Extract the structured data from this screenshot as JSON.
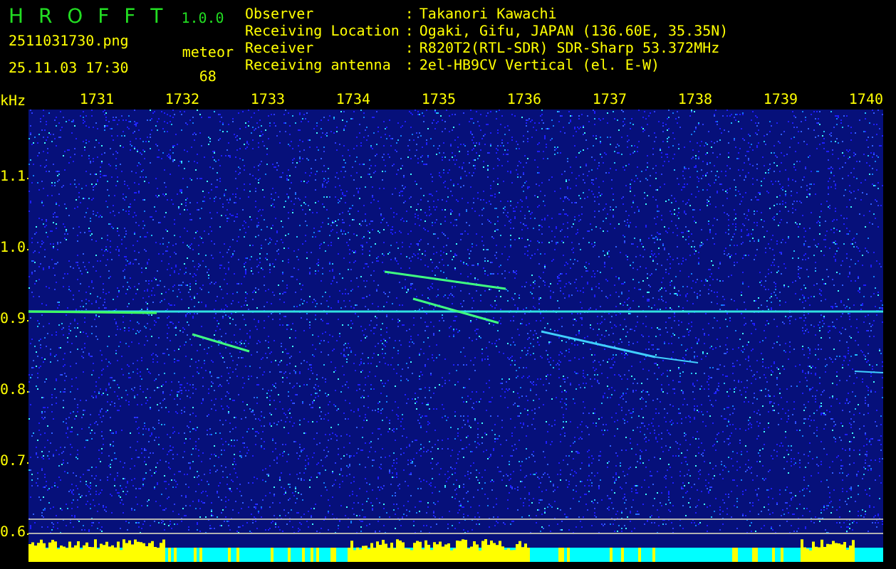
{
  "app": {
    "name": "H R O F F T",
    "version": "1.0.0"
  },
  "file": {
    "name": "2511031730.png",
    "timestamp": "25.11.03 17:30"
  },
  "meteor": {
    "label": "meteor",
    "count": "68"
  },
  "info": [
    {
      "label": "Observer",
      "separator": ":",
      "value": "Takanori Kawachi"
    },
    {
      "label": "Receiving Location",
      "separator": ":",
      "value": "Ogaki, Gifu, JAPAN (136.60E, 35.35N)"
    },
    {
      "label": "Receiver",
      "separator": ":",
      "value": "R820T2(RTL-SDR) SDR-Sharp 53.372MHz"
    },
    {
      "label": "Receiving antenna",
      "separator": ":",
      "value": "2el-HB9CV Vertical (el. E-W)"
    }
  ],
  "y_axis": {
    "unit": "kHz",
    "labels": [
      "1.1",
      "1.0",
      "0.9",
      "0.8",
      "0.7",
      "0.6"
    ]
  },
  "x_axis": {
    "labels": [
      "1731",
      "1732",
      "1733",
      "1734",
      "1735",
      "1736",
      "1737",
      "1738",
      "1739",
      "1740"
    ]
  }
}
